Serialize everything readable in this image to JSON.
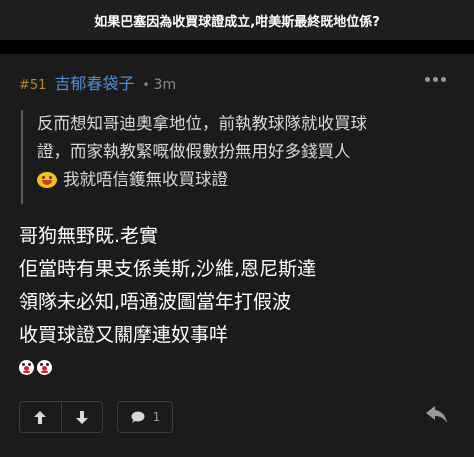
{
  "thread": {
    "title": "如果巴塞因為收買球證成立,咁美斯最終既地位係?"
  },
  "post": {
    "floor": "#51",
    "username": "吉郁春袋子",
    "separator": "•",
    "time": "3m",
    "more_icon": "ellipsis-icon",
    "quote": {
      "line1": "反而想知哥迪奧拿地位，前執教球隊就收買球",
      "line2": "證，而家執教緊嘅做假數扮無用好多錢買人",
      "line3": "我就唔信鑊無收買球證",
      "emoji": "yellow-laughing-face-icon"
    },
    "body": {
      "line1": "哥狗無野既.老實",
      "line2": "佢當時有果支係美斯,沙維,恩尼斯達",
      "line3": "領隊未必知,唔通波圖當年打假波",
      "line4": "收買球證又關摩連奴事咩"
    },
    "smileys": [
      "clown-face-icon",
      "clown-face-icon"
    ]
  },
  "actions": {
    "upvote_icon": "arrow-up-icon",
    "downvote_icon": "arrow-down-icon",
    "comment_icon": "comment-bubble-icon",
    "reply_count": "1",
    "reply_icon": "reply-arrow-icon"
  },
  "colors": {
    "background": "#000000",
    "card": "#1b1b1b",
    "title_bar": "#1f1f1f",
    "username": "#4f8fd8",
    "floor": "#b4872d",
    "muted": "#8a8a8a"
  }
}
